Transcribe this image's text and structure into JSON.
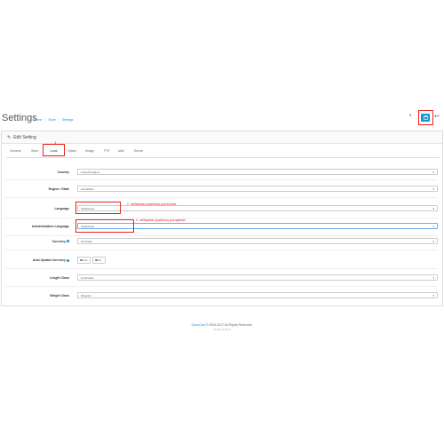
{
  "header": {
    "title": "Settings",
    "breadcrumb": [
      "Home",
      "Store",
      "Settings"
    ],
    "badge": "3",
    "save_icon": "save-icon",
    "back_icon": "reply-icon"
  },
  "panel": {
    "heading": "Edit Setting",
    "heading_icon": "pencil-icon"
  },
  "tabs": [
    {
      "label": "General"
    },
    {
      "label": "Store"
    },
    {
      "label": "Local"
    },
    {
      "label": "Option"
    },
    {
      "label": "Image"
    },
    {
      "label": "FTP"
    },
    {
      "label": "Mail"
    },
    {
      "label": "Server"
    }
  ],
  "tab_marker": "1",
  "form": {
    "country": {
      "label": "Country",
      "value": "United Kingdom"
    },
    "region": {
      "label": "Region / State",
      "value": "Lancashire"
    },
    "language": {
      "label": "Language",
      "value": "Українська",
      "note": "2 - вибираємо українську для вітрини"
    },
    "admin_language": {
      "label": "Administration Language",
      "value": "Українська",
      "note": "3 - вибираємо українську для адмінки"
    },
    "currency": {
      "label": "Currency",
      "value": "US Dollar"
    },
    "auto_update_currency": {
      "label": "Auto Update Currency",
      "yes": "Yes",
      "no": "No",
      "selected": "Yes"
    },
    "length_class": {
      "label": "Length Class",
      "value": "Centimeter"
    },
    "weight_class": {
      "label": "Weight Class",
      "value": "Kilogram"
    }
  },
  "footer": {
    "brand": "OpenCart",
    "copyright": "© 2009-2017 All Rights Reserved.",
    "version": "Version 3.0.2.0"
  },
  "colors": {
    "accent": "#1e91cf",
    "annotation": "#e8201a"
  }
}
